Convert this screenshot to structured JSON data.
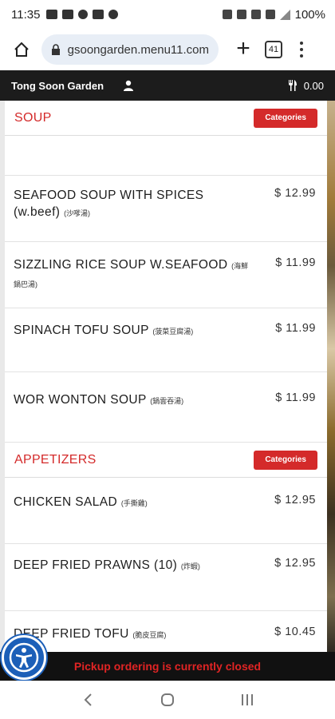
{
  "status_bar": {
    "time": "11:35",
    "battery": "100%"
  },
  "browser": {
    "url": "gsoongarden.menu11.com",
    "tab_count": "41"
  },
  "site_header": {
    "brand": "Tong Soon Garden",
    "cart_total": "0.00"
  },
  "sections": [
    {
      "title": "SOUP",
      "categories_label": "Categories",
      "items": [
        {
          "name": "SEAFOOD SOUP WITH SPICES (w.beef)",
          "zh": "(沙嗲湯)",
          "price": "$ 12.99"
        },
        {
          "name": "SIZZLING RICE SOUP W.SEAFOOD",
          "zh": "(海鮮鍋巴湯)",
          "price": "$ 11.99"
        },
        {
          "name": "SPINACH TOFU SOUP",
          "zh": "(菠菜豆腐湯)",
          "price": "$ 11.99"
        },
        {
          "name": "WOR WONTON SOUP",
          "zh": "(鍋雲吞湯)",
          "price": "$ 11.99"
        }
      ]
    },
    {
      "title": "APPETIZERS",
      "categories_label": "Categories",
      "items": [
        {
          "name": "CHICKEN SALAD",
          "zh": "(手撕雞)",
          "price": "$ 12.95"
        },
        {
          "name": "DEEP FRIED PRAWNS (10)",
          "zh": "(炸蝦)",
          "price": "$ 12.95"
        },
        {
          "name": "DEEP FRIED TOFU",
          "zh": "(脆皮豆腐)",
          "price": "$ 10.45"
        }
      ]
    }
  ],
  "notice": "Pickup ordering is currently closed"
}
